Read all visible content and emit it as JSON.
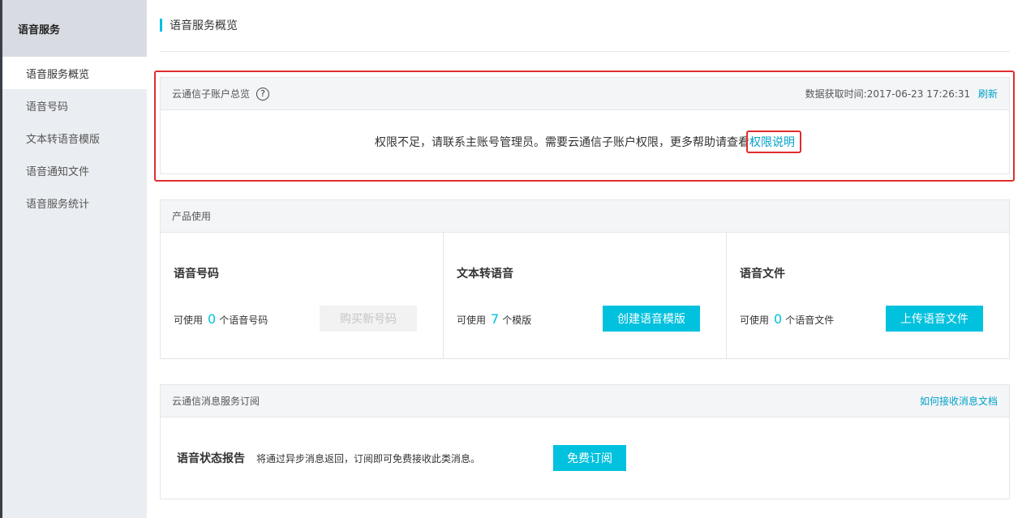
{
  "sidebar": {
    "title": "语音服务",
    "items": [
      {
        "label": "语音服务概览",
        "active": true
      },
      {
        "label": "语音号码"
      },
      {
        "label": "文本转语音模版"
      },
      {
        "label": "语音通知文件"
      },
      {
        "label": "语音服务统计"
      }
    ]
  },
  "page": {
    "title": "语音服务概览"
  },
  "account": {
    "header": "云通信子账户总览",
    "fetch_time_label": "数据获取时间:2017-06-23 17:26:31",
    "refresh_label": "刷新",
    "message": "权限不足，请联系主账号管理员。需要云通信子账户权限，更多帮助请查看",
    "permission_link": "权限说明"
  },
  "product": {
    "header": "产品使用",
    "columns": [
      {
        "title": "语音号码",
        "prefix": "可使用",
        "count": "0",
        "suffix": "个语音号码",
        "button": "购买新号码",
        "button_enabled": false
      },
      {
        "title": "文本转语音",
        "prefix": "可使用",
        "count": "7",
        "suffix": "个模版",
        "button": "创建语音模版",
        "button_enabled": true
      },
      {
        "title": "语音文件",
        "prefix": "可使用",
        "count": "0",
        "suffix": "个语音文件",
        "button": "上传语音文件",
        "button_enabled": true
      }
    ]
  },
  "subscription": {
    "header": "云通信消息服务订阅",
    "doc_link": "如何接收消息文档",
    "label": "语音状态报告",
    "description": "将通过异步消息返回，订阅即可免费接收此类消息。",
    "button": "免费订阅"
  },
  "colors": {
    "accent": "#00c1de",
    "link": "#00a2ca",
    "highlight": "#e02d2d"
  },
  "icons": {
    "help": "question-circle-icon"
  }
}
